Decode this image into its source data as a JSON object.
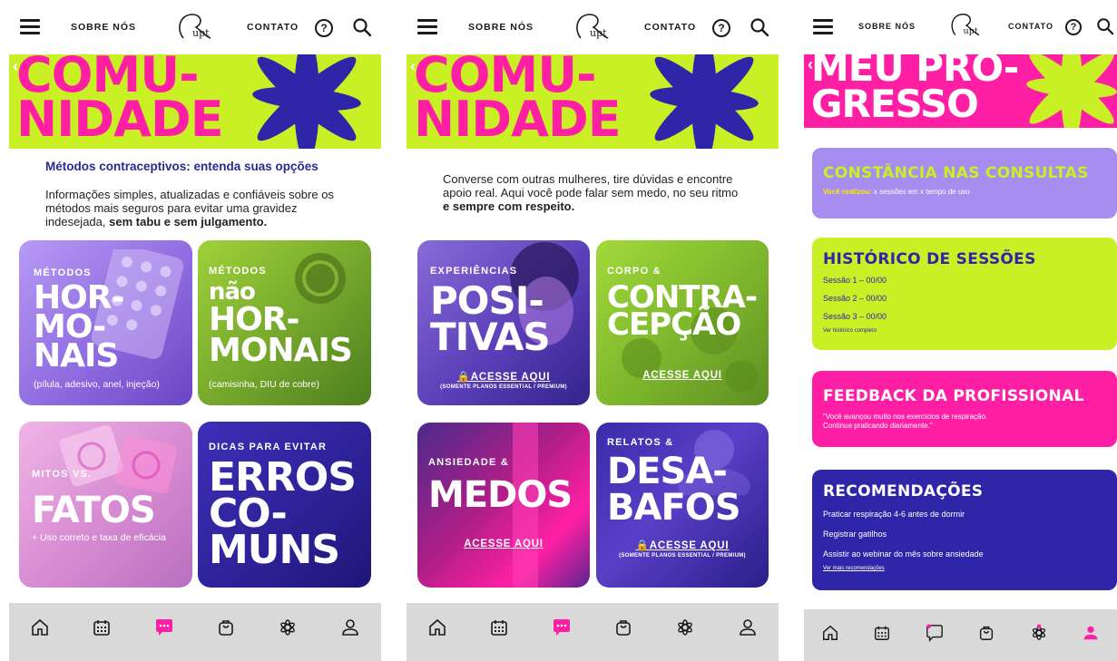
{
  "colors": {
    "lime": "#c8f024",
    "pink": "#ff1fa4",
    "navy": "#2f25a8",
    "lavender": "#a88df0",
    "violet": "#7a54d8",
    "dark": "#1a1a1a"
  },
  "topbar": {
    "about_label": "SOBRE NÓS",
    "contact_label": "CONTATO",
    "help_label": "?",
    "logo_text": "Rupt"
  },
  "nav_icons": [
    "home-icon",
    "calendar-icon",
    "chat-icon",
    "bag-icon",
    "flower-icon",
    "user-icon"
  ],
  "screen1": {
    "hero_title_line1": "COMU-",
    "hero_title_line2": "NIDADE",
    "intro_heading": "Métodos contraceptivos: entenda suas opções",
    "intro_text": "Informações simples, atualizadas e confiáveis sobre os métodos mais seguros para evitar uma gravidez indesejada,",
    "intro_bold": "sem tabu e sem julgamento.",
    "cards": [
      {
        "kicker": "MÉTODOS",
        "big1": "HOR-",
        "big2": "MO-",
        "big3": "NAIS",
        "sub": "(pílula, adesivo, anel, injeção)"
      },
      {
        "kicker": "MÉTODOS",
        "big1": "não",
        "big2": "HOR-",
        "big3": "MONAIS",
        "sub": "(camisinha, DIU de cobre)"
      },
      {
        "kicker": "MITOS VS.",
        "big1": "FATOS",
        "sub": "+ Uso correto e taxa de eficácia"
      },
      {
        "kicker": "DICAS PARA EVITAR",
        "big1": "ERROS",
        "big2": "CO-",
        "big3": "MUNS"
      }
    ]
  },
  "screen2": {
    "hero_title_line1": "COMU-",
    "hero_title_line2": "NIDADE",
    "intro_text": "Converse com outras mulheres, tire dúvidas e encontre apoio real. Aqui você pode falar sem medo, no seu ritmo",
    "intro_bold": "e sempre com respeito.",
    "cards": [
      {
        "kicker": "EXPERIÊNCIAS",
        "big1": "POSI-",
        "big2": "TIVAS",
        "cta": "🔒ACESSE AQUI",
        "cta_note": "(SOMENTE PLANOS ESSENTIAL / PREMIUM)"
      },
      {
        "kicker": "CORPO &",
        "big1": "CONTRA-",
        "big2": "CEPÇÃO",
        "cta": "ACESSE AQUI"
      },
      {
        "kicker": "ANSIEDADE &",
        "big1": "MEDOS",
        "cta": "ACESSE AQUI"
      },
      {
        "kicker": "RELATOS &",
        "big1": "DESA-",
        "big2": "BAFOS",
        "cta": "🔒ACESSE AQUI",
        "cta_note": "(SOMENTE PLANOS ESSENTIAL / PREMIUM)"
      }
    ]
  },
  "screen3": {
    "hero_title_line1": "MEU PRO-",
    "hero_title_line2": "GRESSO",
    "constancia": {
      "title": "CONSTÂNCIA NAS CONSULTAS",
      "lead": "Você realizou:",
      "text": "x sessões em x tempo de uso"
    },
    "historico": {
      "title": "HISTÓRICO DE SESSÕES",
      "items": [
        "Sessão 1 – 00/00",
        "Sessão 2 – 00/00",
        "Sessão 3 – 00/00"
      ],
      "link": "Ver histórico completo"
    },
    "feedback": {
      "title": "FEEDBACK DA PROFISSIONAL",
      "text1": "\"Você avançou muito nos exercícios de respiração.",
      "text2": "Continue praticando diariamente.\""
    },
    "recomendacoes": {
      "title": "RECOMENDAÇÕES",
      "items": [
        "Praticar respiração 4-6 antes de dormir",
        "Registrar gatilhos",
        "Assistir ao webinar do mês sobre ansiedade"
      ],
      "link": "Ver mais recomendações"
    }
  }
}
